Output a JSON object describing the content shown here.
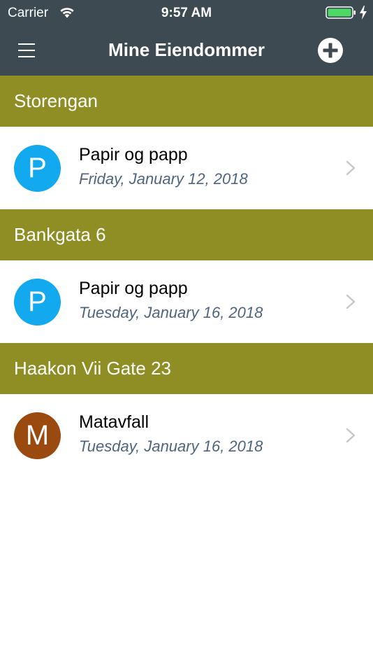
{
  "status_bar": {
    "carrier": "Carrier",
    "time": "9:57 AM",
    "wifi_icon": "wifi-icon",
    "battery_icon": "battery-icon",
    "charging_icon": "charging-bolt-icon",
    "battery_color": "#4cd964"
  },
  "nav": {
    "title": "Mine Eiendommer",
    "menu_icon": "hamburger-menu-icon",
    "add_icon": "plus-circle-icon",
    "background": "#3d4a52"
  },
  "colors": {
    "section_header": "#8e8e25",
    "avatar_p": "#12a9ee",
    "avatar_m": "#9b4a0f",
    "date_text": "#4f6580",
    "chevron": "#c7c7cc"
  },
  "sections": [
    {
      "name": "Storengan",
      "items": [
        {
          "initial": "P",
          "title": "Papir og papp",
          "date": "Friday, January 12, 2018"
        }
      ]
    },
    {
      "name": "Bankgata 6",
      "items": [
        {
          "initial": "P",
          "title": "Papir og papp",
          "date": "Tuesday, January 16, 2018"
        }
      ]
    },
    {
      "name": "Haakon Vii Gate 23",
      "items": [
        {
          "initial": "M",
          "title": "Matavfall",
          "date": "Tuesday, January 16, 2018"
        }
      ]
    }
  ]
}
